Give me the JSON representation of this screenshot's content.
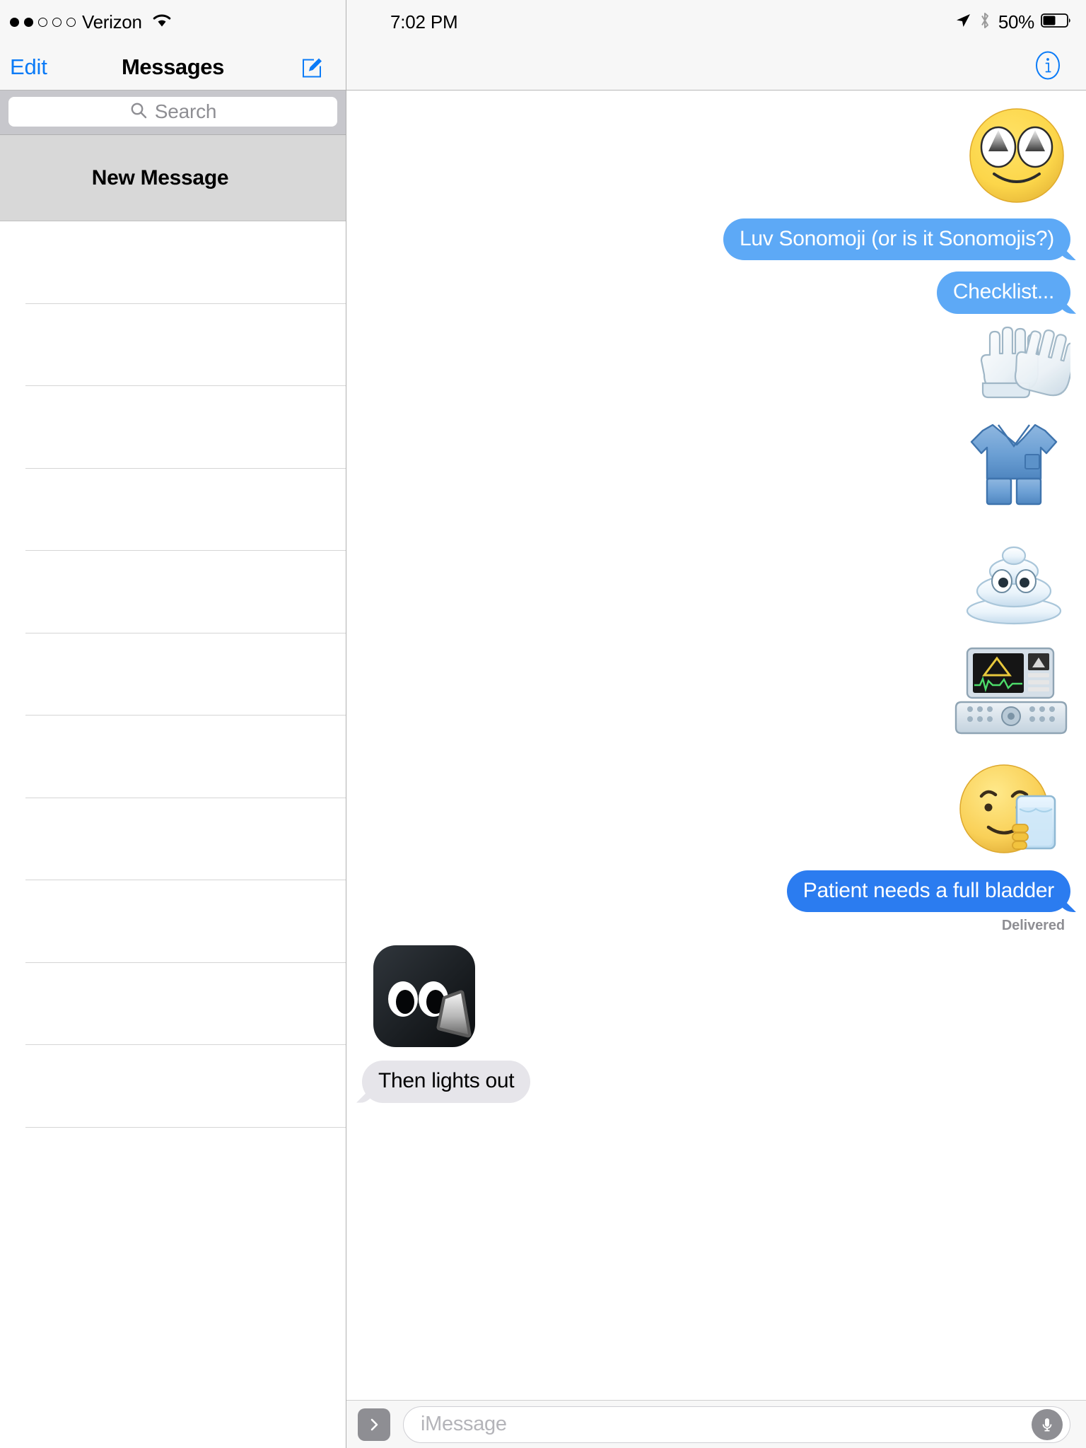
{
  "status_bar": {
    "carrier": "Verizon",
    "signal_dots_filled": 2,
    "signal_dots_total": 5,
    "wifi_icon": "wifi-icon",
    "time": "7:02 PM",
    "location_icon": "location-arrow-icon",
    "bluetooth_icon": "bluetooth-icon",
    "battery_percent": "50%",
    "battery_icon": "battery-icon"
  },
  "sidebar": {
    "edit_label": "Edit",
    "title": "Messages",
    "compose_icon": "compose-icon",
    "search": {
      "placeholder": "Search",
      "icon": "search-icon"
    },
    "new_message_label": "New Message",
    "empty_row_count": 11
  },
  "conversation": {
    "info_icon": "info-icon",
    "messages": [
      {
        "type": "sticker",
        "name": "sonomoji-eyes-face",
        "side": "out"
      },
      {
        "type": "text",
        "text": "Luv Sonomoji (or is it Sonomojis?)",
        "side": "out",
        "bubble": "blue-light",
        "tail": true
      },
      {
        "type": "text",
        "text": "Checklist...",
        "side": "out",
        "bubble": "blue-light",
        "tail": true
      },
      {
        "type": "sticker",
        "name": "sonomoji-gloves",
        "side": "out"
      },
      {
        "type": "sticker",
        "name": "sonomoji-scrubs",
        "side": "out"
      },
      {
        "type": "sticker",
        "name": "sonomoji-gel",
        "side": "out"
      },
      {
        "type": "sticker",
        "name": "sonomoji-ultrasound-machine",
        "side": "out"
      },
      {
        "type": "sticker",
        "name": "sonomoji-drinking-water-face",
        "side": "out"
      },
      {
        "type": "text",
        "text": "Patient needs a full bladder",
        "side": "out",
        "bubble": "blue-deep",
        "tail": true
      },
      {
        "type": "status",
        "text": "Delivered"
      },
      {
        "type": "app-icon",
        "name": "sonomoji-app-icon",
        "side": "in"
      },
      {
        "type": "text",
        "text": "Then lights out",
        "side": "in",
        "bubble": "gray",
        "tail": true
      }
    ],
    "input": {
      "apps_icon": "chevron-right-icon",
      "placeholder": "iMessage",
      "mic_icon": "microphone-icon"
    }
  },
  "colors": {
    "accent_blue": "#0b7bf7",
    "bubble_blue_light": "#5da9f6",
    "bubble_blue_deep": "#2b7cf0",
    "bubble_gray": "#e6e5ea",
    "chrome_gray": "#f7f7f7",
    "search_band": "#c7c7cc",
    "selected_row": "#d8d8d8"
  }
}
